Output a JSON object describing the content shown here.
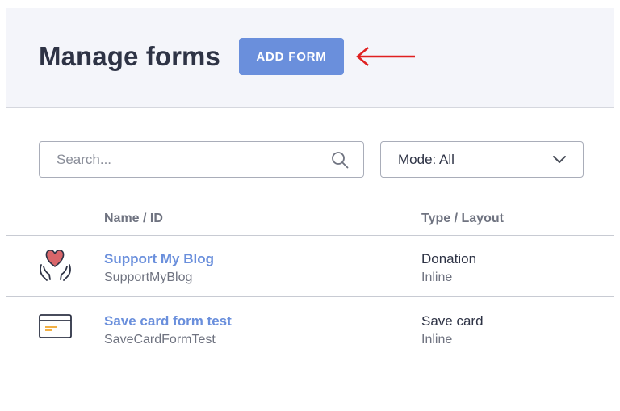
{
  "header": {
    "title": "Manage forms",
    "add_button": "ADD FORM"
  },
  "filters": {
    "search_placeholder": "Search...",
    "mode_label": "Mode: All"
  },
  "table": {
    "columns": [
      "Name / ID",
      "Type / Layout"
    ],
    "rows": [
      {
        "icon": "heart-hands-icon",
        "name": "Support My Blog",
        "id": "SupportMyBlog",
        "type": "Donation",
        "layout": "Inline"
      },
      {
        "icon": "credit-card-icon",
        "name": "Save card form test",
        "id": "SaveCardFormTest",
        "type": "Save card",
        "layout": "Inline"
      }
    ]
  },
  "colors": {
    "accent": "#6a8fdc",
    "title": "#2e3345",
    "header_bg": "#f4f5fa",
    "annotation_arrow": "#e02020",
    "heart": "#d9666a",
    "card_stripe": "#f0a830"
  }
}
